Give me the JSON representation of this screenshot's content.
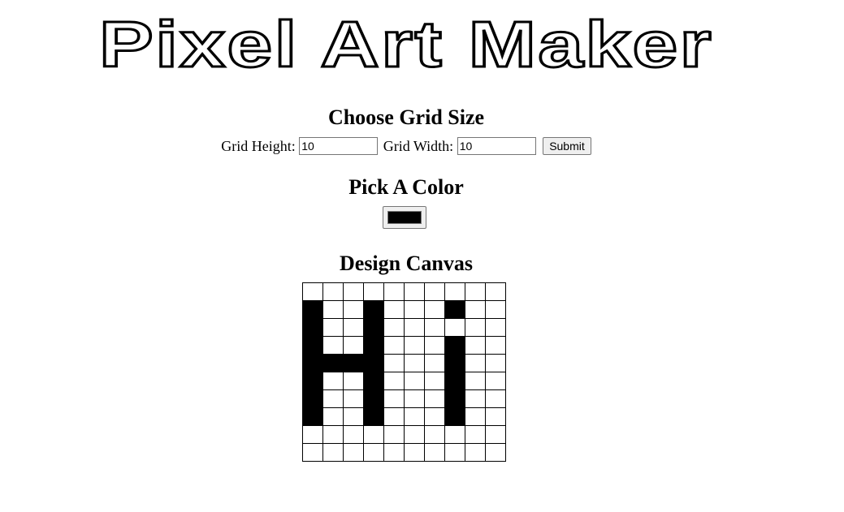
{
  "logo": {
    "text": "Pixel Art Maker"
  },
  "grid_size": {
    "title": "Choose Grid Size",
    "height_label": "Grid Height:",
    "height_value": "10",
    "width_label": "Grid Width:",
    "width_value": "10",
    "submit_label": "Submit"
  },
  "color": {
    "title": "Pick A Color",
    "value": "#000000"
  },
  "canvas": {
    "title": "Design Canvas",
    "rows": 10,
    "cols": 10,
    "pixels": [
      [
        0,
        0,
        0,
        0,
        0,
        0,
        0,
        0,
        0,
        0
      ],
      [
        1,
        0,
        0,
        1,
        0,
        0,
        0,
        1,
        0,
        0
      ],
      [
        1,
        0,
        0,
        1,
        0,
        0,
        0,
        0,
        0,
        0
      ],
      [
        1,
        0,
        0,
        1,
        0,
        0,
        0,
        1,
        0,
        0
      ],
      [
        1,
        1,
        1,
        1,
        0,
        0,
        0,
        1,
        0,
        0
      ],
      [
        1,
        0,
        0,
        1,
        0,
        0,
        0,
        1,
        0,
        0
      ],
      [
        1,
        0,
        0,
        1,
        0,
        0,
        0,
        1,
        0,
        0
      ],
      [
        1,
        0,
        0,
        1,
        0,
        0,
        0,
        1,
        0,
        0
      ],
      [
        0,
        0,
        0,
        0,
        0,
        0,
        0,
        0,
        0,
        0
      ],
      [
        0,
        0,
        0,
        0,
        0,
        0,
        0,
        0,
        0,
        0
      ]
    ],
    "filled_color": "#000000",
    "empty_color": "#ffffff"
  }
}
